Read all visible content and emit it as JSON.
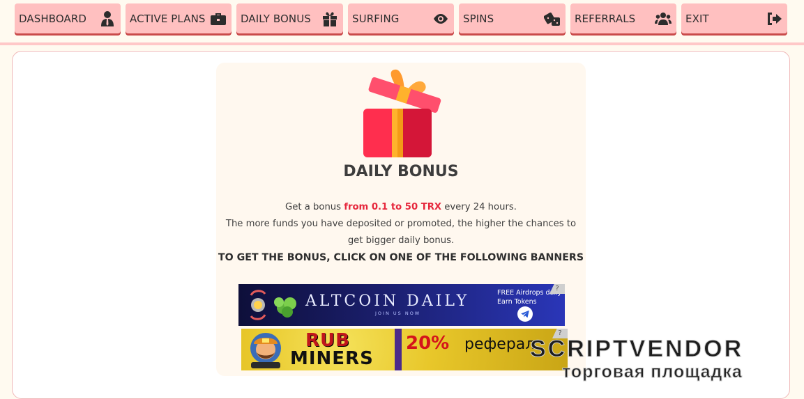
{
  "nav": {
    "items": [
      {
        "label": "DASHBOARD",
        "icon": "user-tie-icon"
      },
      {
        "label": "ACTIVE PLANS",
        "icon": "briefcase-icon"
      },
      {
        "label": "DAILY BONUS",
        "icon": "gift-icon"
      },
      {
        "label": "SURFING",
        "icon": "eye-icon"
      },
      {
        "label": "SPINS",
        "icon": "dice-icon"
      },
      {
        "label": "REFERRALS",
        "icon": "users-icon"
      },
      {
        "label": "EXIT",
        "icon": "sign-out-icon"
      }
    ]
  },
  "bonus": {
    "title": "DAILY BONUS",
    "line1_prefix": "Get a bonus ",
    "line1_highlight": "from 0.1 to 50 TRX",
    "line1_suffix": " every 24 hours.",
    "line2": "The more funds you have deposited or promoted, the higher the chances to get bigger daily bonus.",
    "cta": "TO GET THE BONUS, CLICK ON ONE OF THE FOLLOWING BANNERS"
  },
  "banners": {
    "altcoin": {
      "title": "ALTCOIN DAILY",
      "subtitle": "JOIN US NOW",
      "right_line1": "FREE Airdrops daily",
      "right_line2": "Earn Tokens",
      "help": "?"
    },
    "rubminers": {
      "word1": "RUB",
      "word2": "MINERS",
      "percent": "20%",
      "text": "реферал",
      "help": "?"
    }
  },
  "watermark": {
    "main": "SCRIPTVENDOR",
    "sub": "торговая площадка"
  },
  "colors": {
    "nav_bg": "#ffc0c0",
    "accent_red": "#e6273c",
    "panel_bg": "#fff8ef"
  }
}
